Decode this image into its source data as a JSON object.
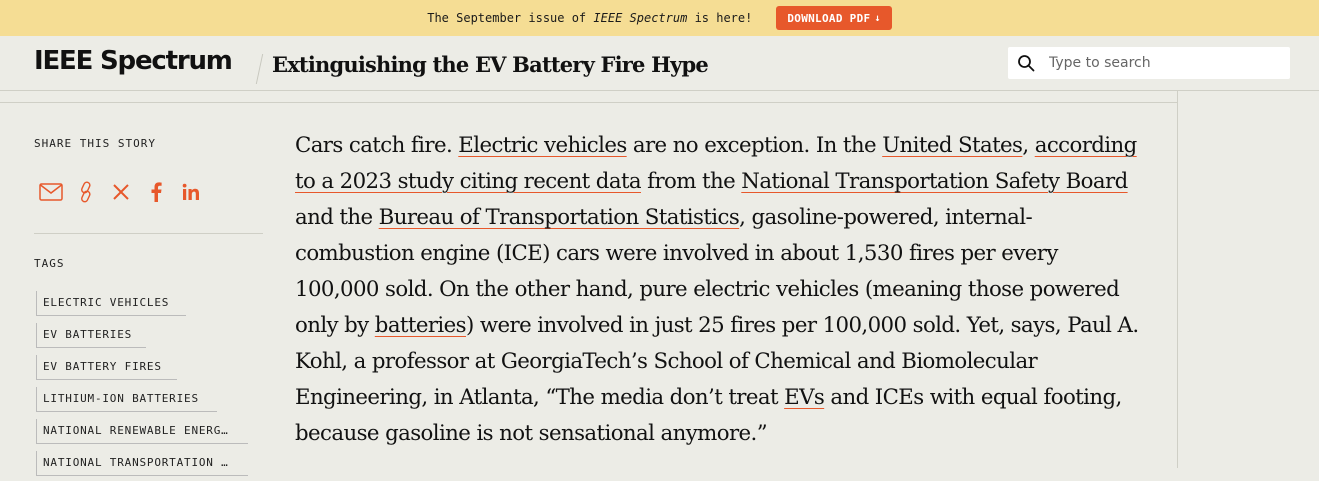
{
  "banner": {
    "prefix": "The September issue of",
    "publication": "IEEE Spectrum",
    "suffix": "is here!",
    "button_label": "DOWNLOAD PDF",
    "button_arrow": "↓",
    "accent": "#e7582b"
  },
  "header": {
    "logo": "IEEE Spectrum",
    "article_title": "Extinguishing the EV Battery Fire Hype",
    "search_placeholder": "Type to search"
  },
  "sidebar": {
    "share_label": "SHARE THIS STORY",
    "share_icons": [
      "email-icon",
      "link-icon",
      "x-icon",
      "facebook-icon",
      "linkedin-icon"
    ],
    "tags_label": "TAGS",
    "tags": [
      "ELECTRIC VEHICLES",
      "EV BATTERIES",
      "EV BATTERY FIRES",
      "LITHIUM-ION BATTERIES",
      "NATIONAL RENEWABLE ENERGY LABORATORY",
      "NATIONAL TRANSPORTATION SAFETY BOARD"
    ]
  },
  "article": {
    "l1_a": "Cars catch fire.",
    "l1_link1": "Electric vehicles",
    "l1_b": "are no exception. In the",
    "l1_link2": "United States",
    "l1_c": ",",
    "l1_link3": "according",
    "l2_link1": "to a 2023 study citing recent data",
    "l2_a": "from the",
    "l2_link2": "National Transportation Safety Board",
    "l3_a": "and the",
    "l3_link1": "Bureau of Transportation Statistics",
    "l3_b": ", gasoline-powered, internal-",
    "l4": "combustion engine (ICE) cars were involved in about 1,530 fires per every",
    "l5": "100,000 sold. On the other hand, pure electric vehicles (meaning those powered",
    "l6_a": "only by",
    "l6_link1": "batteries",
    "l6_b": ") were involved in just 25 fires per 100,000 sold. Yet, says, Paul A.",
    "l7": "Kohl, a professor at GeorgiaTech’s School of Chemical and Biomolecular",
    "l8_a": "Engineering, in Atlanta, “The media don’t treat",
    "l8_link1": "EVs",
    "l8_b": "and ICEs with equal footing,",
    "l9": "because gasoline is not sensational anymore.”"
  }
}
